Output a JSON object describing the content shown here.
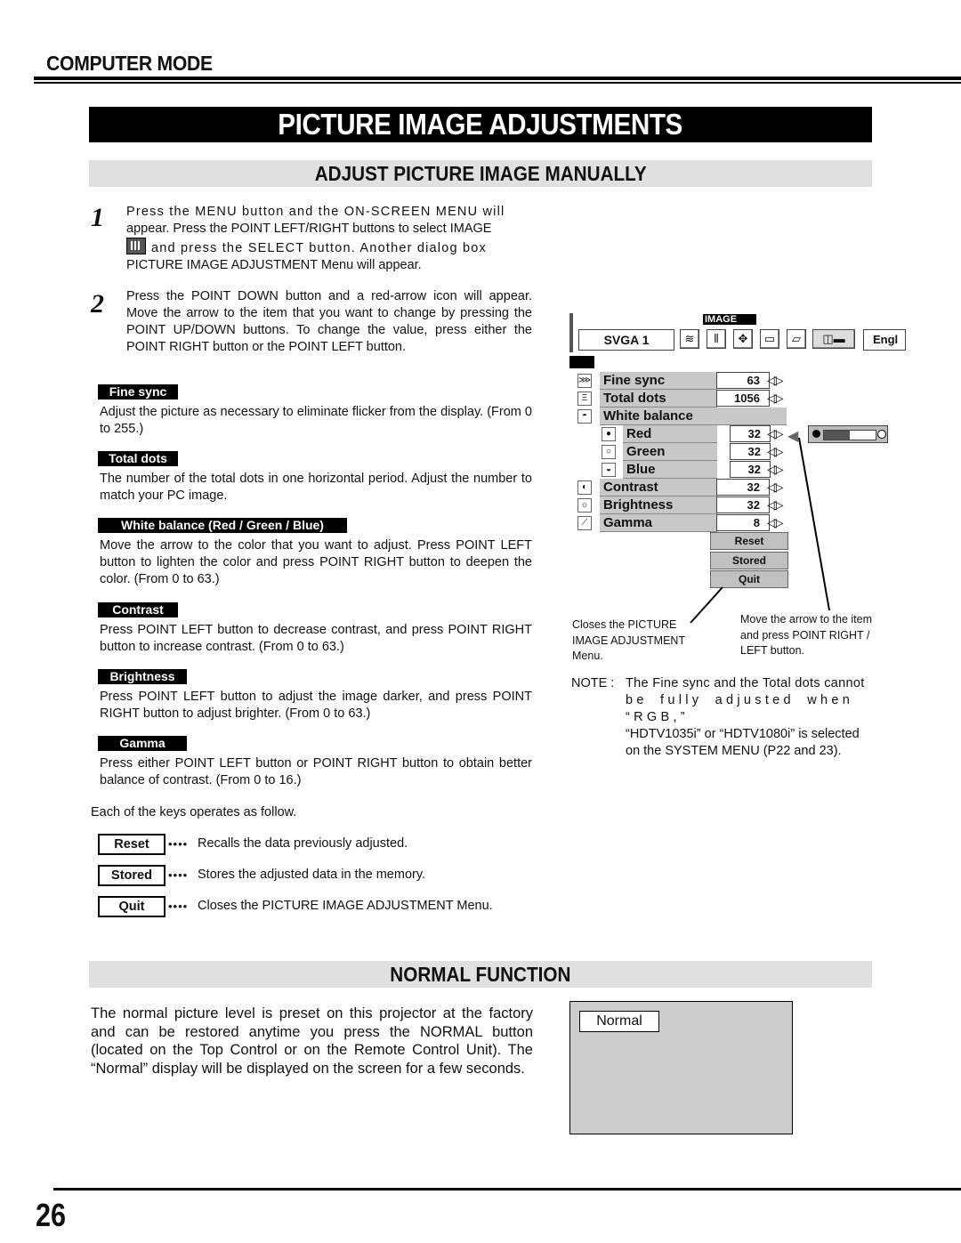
{
  "header": {
    "section": "COMPUTER MODE",
    "title": "PICTURE IMAGE ADJUSTMENTS",
    "subtitle": "ADJUST PICTURE IMAGE MANUALLY"
  },
  "steps": [
    {
      "number": "1",
      "line1": "Press the MENU button and the ON-SCREEN MENU will",
      "line2": "appear.  Press the POINT LEFT/RIGHT buttons to select IMAGE",
      "line3": "and press the SELECT button.  Another dialog box",
      "line4": "PICTURE IMAGE ADJUSTMENT Menu will appear.",
      "icon": "image-adjust-icon"
    },
    {
      "number": "2",
      "text": "Press the POINT DOWN button and a red-arrow icon will appear.  Move the arrow to the item that you want to change by pressing the POINT UP/DOWN buttons.  To change the value, press either the POINT RIGHT button or the POINT LEFT button."
    }
  ],
  "items": [
    {
      "label": "Fine sync",
      "description": "Adjust the picture as necessary to eliminate flicker from the display.  (From 0 to 255.)"
    },
    {
      "label": "Total dots",
      "description": "The number of the total dots in one horizontal period.  Adjust the number to match your PC image."
    },
    {
      "label": "White balance (Red / Green / Blue)",
      "description": "Move the arrow to the color that you want to adjust.  Press POINT LEFT button to lighten the color and press POINT RIGHT button to deepen the color.  (From 0 to 63.)"
    },
    {
      "label": "Contrast",
      "description": "Press POINT LEFT button to decrease contrast, and press POINT RIGHT button to increase contrast.  (From 0 to 63.)"
    },
    {
      "label": "Brightness",
      "description": "Press POINT LEFT button to adjust the image darker, and press POINT RIGHT button to  adjust brighter.  (From 0 to 63.)"
    },
    {
      "label": "Gamma",
      "description": "Press either POINT LEFT button or POINT RIGHT button to obtain better balance of contrast.  (From 0 to 16.)"
    }
  ],
  "keys": {
    "intro": "Each of the keys operates as follow.",
    "dots": "••••",
    "list": [
      {
        "label": "Reset",
        "description": "Recalls the data previously adjusted."
      },
      {
        "label": "Stored",
        "description": "Stores the adjusted data in the memory."
      },
      {
        "label": "Quit",
        "description": "Closes the PICTURE IMAGE ADJUSTMENT Menu."
      }
    ]
  },
  "osd": {
    "menu_title": "IMAGE",
    "system": "SVGA 1",
    "language": "Engl",
    "toolbar_icons": [
      "image-adjust-icon",
      "image-level-icon",
      "position-icon",
      "pc-adjust-icon",
      "screen-icon",
      "setting-icon"
    ],
    "rows": [
      {
        "label": "Fine sync",
        "value": "63",
        "icon": "fine-sync-icon",
        "glyph": "⋙"
      },
      {
        "label": "Total dots",
        "value": "1056",
        "icon": "total-dots-icon",
        "glyph": "Ξ"
      },
      {
        "label": "White balance",
        "value": "",
        "icon": "white-balance-icon",
        "glyph": "◓"
      },
      {
        "label": "Red",
        "value": "32",
        "icon": "red-icon",
        "glyph": "●",
        "sub": true
      },
      {
        "label": "Green",
        "value": "32",
        "icon": "green-icon",
        "glyph": "○",
        "sub": true
      },
      {
        "label": "Blue",
        "value": "32",
        "icon": "blue-icon",
        "glyph": "◒",
        "sub": true
      },
      {
        "label": "Contrast",
        "value": "32",
        "icon": "contrast-icon",
        "glyph": "◐"
      },
      {
        "label": "Brightness",
        "value": "32",
        "icon": "brightness-icon",
        "glyph": "☼"
      },
      {
        "label": "Gamma",
        "value": "8",
        "icon": "gamma-icon",
        "glyph": "⟋"
      }
    ],
    "arrows": "◁▷",
    "slider": {
      "value": 32,
      "min": 0,
      "max": 63
    },
    "buttons": [
      "Reset",
      "Stored",
      "Quit"
    ],
    "callout_left": [
      "Closes the PICTURE",
      "IMAGE ADJUSTMENT",
      "Menu."
    ],
    "callout_right": [
      "Move the arrow to the item",
      "and press POINT RIGHT /",
      "LEFT button."
    ]
  },
  "note": {
    "prefix": "NOTE :",
    "lines": [
      "The Fine sync and the Total dots cannot",
      "be fully adjusted when “RGB,”",
      "“HDTV1035i” or “HDTV1080i” is selected",
      "on the SYSTEM MENU (P22 and 23)."
    ]
  },
  "normal": {
    "heading": "NORMAL FUNCTION",
    "text": "The normal picture level is preset on this projector at the factory and can be restored anytime you press the NORMAL button (located on the Top Control or on the Remote Control Unit).  The “Normal” display will be displayed on the screen for a few seconds.",
    "screen_label": "Normal"
  },
  "footer": {
    "page": "26"
  }
}
